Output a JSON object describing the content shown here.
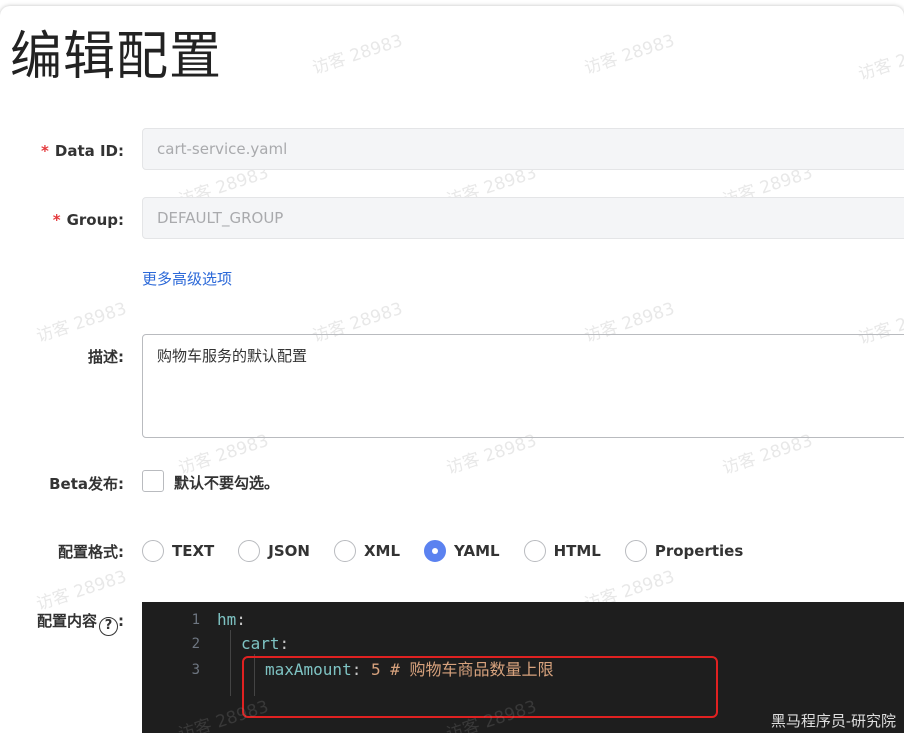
{
  "page": {
    "title": "编辑配置",
    "watermark": "访客 28983"
  },
  "form": {
    "data_id": {
      "label": "Data ID:",
      "required_mark": "*",
      "value": "cart-service.yaml"
    },
    "group": {
      "label": "Group:",
      "required_mark": "*",
      "value": "DEFAULT_GROUP"
    },
    "advanced_link": "更多高级选项",
    "description": {
      "label": "描述:",
      "value": "购物车服务的默认配置"
    },
    "beta": {
      "label": "Beta发布:",
      "checkbox_label": "默认不要勾选。",
      "checked": false
    },
    "format": {
      "label": "配置格式:",
      "options": [
        {
          "label": "TEXT",
          "checked": false
        },
        {
          "label": "JSON",
          "checked": false
        },
        {
          "label": "XML",
          "checked": false
        },
        {
          "label": "YAML",
          "checked": true
        },
        {
          "label": "HTML",
          "checked": false
        },
        {
          "label": "Properties",
          "checked": false
        }
      ]
    },
    "content": {
      "label": "配置内容",
      "help_icon": "?"
    }
  },
  "editor": {
    "lines": [
      {
        "number": "1",
        "key": "hm",
        "punct": ":"
      },
      {
        "number": "2",
        "key": "cart",
        "punct": ":"
      },
      {
        "number": "3",
        "key": "maxAmount",
        "punct": ":",
        "value": "5",
        "comment": "# 购物车商品数量上限"
      }
    ]
  },
  "footer": {
    "caption": "黑马程序员-研究院"
  },
  "colors": {
    "accent": "#5b82f0",
    "link": "#2c69d8",
    "required": "#e4393c",
    "editor_bg": "#1e1e1e",
    "highlight_box": "#e02121"
  }
}
